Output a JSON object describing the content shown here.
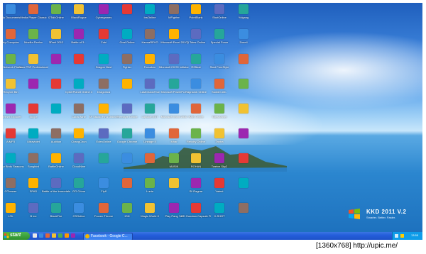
{
  "desktop": {
    "brand_title": "KKD 2011 V.2",
    "brand_sub": "Smarter. Better. Faster.",
    "icons": [
      [
        "My Documents",
        "Media Player Classic",
        "i2TalkOnline",
        "BlackRogue",
        "Cybergames",
        "",
        "InsOnline",
        "MFighter",
        "PointBlank",
        "ShotOnline",
        "Yulgang"
      ],
      [
        "My Computer",
        "Mozilla Firefox",
        "3Dmit 2012",
        "Battle of 3...",
        "Cubi",
        "Goal Online",
        "KarmaREVO",
        "Microsoft Excel 2010",
        "Q Tales Online",
        "Special Force",
        "Zone4"
      ],
      [
        "My Network Places",
        "Nero PDF Professional",
        "",
        "",
        "Dragon Nest",
        "Fighter",
        "Forsaken",
        "Microsoft iSCSI Initiator",
        "R2Beat",
        "Start FreeStyle",
        ""
      ],
      [
        "Recycle Bin",
        "",
        "",
        "CyberPlanet Online 4",
        "Dragonica",
        "",
        "LastChaosThai",
        "Microsoft PowerPo...",
        "Ragnarok Online",
        "Sudden Att..",
        ""
      ],
      [
        "Internet Explorer",
        "Skype",
        "",
        "Cabal Nine",
        "SF Stadio FIFA Online 4",
        "Freestyle Online",
        "Laplace EST",
        "Microsoft Word 2010",
        "RAN Online",
        "Talesrunner",
        ""
      ],
      [
        "AIMP3",
        "Ultraviolet",
        "Audition",
        "ChangChun",
        "EdenOnline",
        "Google Chrome",
        "Lineage II",
        "Mhar",
        "Revolty Online",
        "Tantra",
        ""
      ],
      [
        "Angry Birds Seasons",
        "Songbird",
        "BattleOnline",
        "CloudNine",
        "",
        "",
        "",
        "MUSIK",
        "ROHAN",
        "Twelve Sky2",
        ""
      ],
      [
        "CCleaner",
        "SPAD",
        "Battle of the Immortals",
        "GO Crime",
        "Flyff",
        "",
        "Lunia",
        "",
        "Sil Ragnar",
        "Valent",
        ""
      ],
      [
        "LOL",
        "B ine",
        "BlackFire",
        "CSOnline",
        "Frozen Throne",
        "ION",
        "Magic World II",
        "Play Pang Ya!",
        "SD Gundam Capsule Fig...",
        "X-SHOT",
        ""
      ]
    ]
  },
  "taskbar": {
    "start_label": "start",
    "window_label": "Facebook - Google C...",
    "clock": "13:55"
  },
  "footer": {
    "watermark": "[1360x768] http://upic.me/"
  },
  "colors": {
    "taskbar": "#245edb",
    "start": "#3aa43a"
  }
}
